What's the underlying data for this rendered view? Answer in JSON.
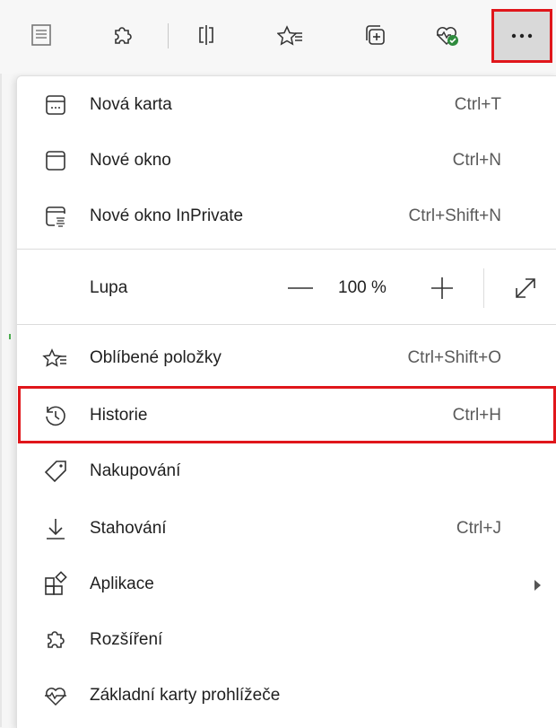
{
  "toolbar": {
    "buttons": [
      {
        "name": "reading-view-icon"
      },
      {
        "name": "extensions-icon"
      },
      {
        "name": "split-screen-icon"
      },
      {
        "name": "favorites-icon"
      },
      {
        "name": "collections-icon"
      },
      {
        "name": "browser-essentials-icon"
      },
      {
        "name": "more-icon"
      }
    ]
  },
  "menu": {
    "new_tab": {
      "label": "Nová karta",
      "shortcut": "Ctrl+T",
      "icon": "new-tab-icon"
    },
    "new_window": {
      "label": "Nové okno",
      "shortcut": "Ctrl+N",
      "icon": "window-icon"
    },
    "new_private": {
      "label": "Nové okno InPrivate",
      "shortcut": "Ctrl+Shift+N",
      "icon": "inprivate-icon"
    },
    "zoom": {
      "label": "Lupa",
      "value": "100 %"
    },
    "favorites": {
      "label": "Oblíbené položky",
      "shortcut": "Ctrl+Shift+O",
      "icon": "favorites-icon"
    },
    "history": {
      "label": "Historie",
      "shortcut": "Ctrl+H",
      "icon": "history-icon"
    },
    "shopping": {
      "label": "Nakupování",
      "icon": "tag-icon"
    },
    "downloads": {
      "label": "Stahování",
      "shortcut": "Ctrl+J",
      "icon": "download-icon"
    },
    "apps": {
      "label": "Aplikace",
      "icon": "apps-icon"
    },
    "extensions": {
      "label": "Rozšíření",
      "icon": "puzzle-icon"
    },
    "essentials": {
      "label": "Základní karty prohlížeče",
      "icon": "heart-pulse-icon"
    }
  },
  "colors": {
    "highlight": "#e0161b",
    "essentials_badge": "#2e8b3d"
  }
}
